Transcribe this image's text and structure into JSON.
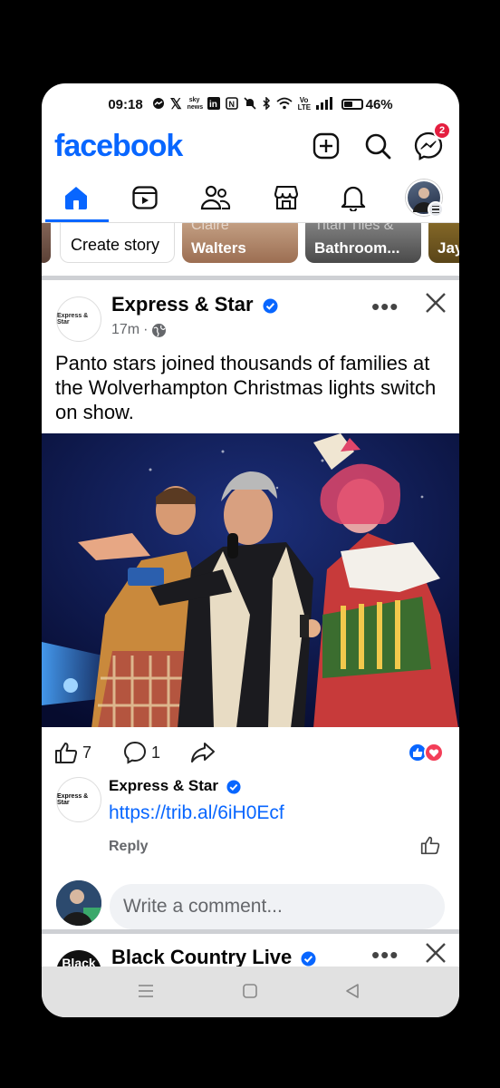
{
  "status": {
    "time": "09:18",
    "battery": "46%",
    "volte": "Vo LTE",
    "sky": "sky news"
  },
  "header": {
    "logo": "facebook",
    "messenger_badge": "2"
  },
  "stories": {
    "create_label": "Create story",
    "items": [
      {
        "label": "Walters",
        "ghost": "Claire"
      },
      {
        "label": "Bathroom...",
        "ghost": "Titan Tiles &"
      },
      {
        "label": "Jay",
        "ghost": ""
      }
    ]
  },
  "post": {
    "author": "Express & Star",
    "avatar_text": "Express & Star",
    "time": "17m",
    "text": "Panto stars joined thousands of families at the Wolverhampton Christmas lights switch on show.",
    "likes": "7",
    "comments": "1"
  },
  "comment": {
    "author": "Express & Star",
    "link": "https://trib.al/6iH0Ecf",
    "reply": "Reply"
  },
  "composer": {
    "placeholder": "Write a comment..."
  },
  "next_post": {
    "author": "Black Country Live",
    "avatar_text": "Black"
  },
  "colors": {
    "brand": "#0866ff",
    "badge": "#e41e3f"
  }
}
